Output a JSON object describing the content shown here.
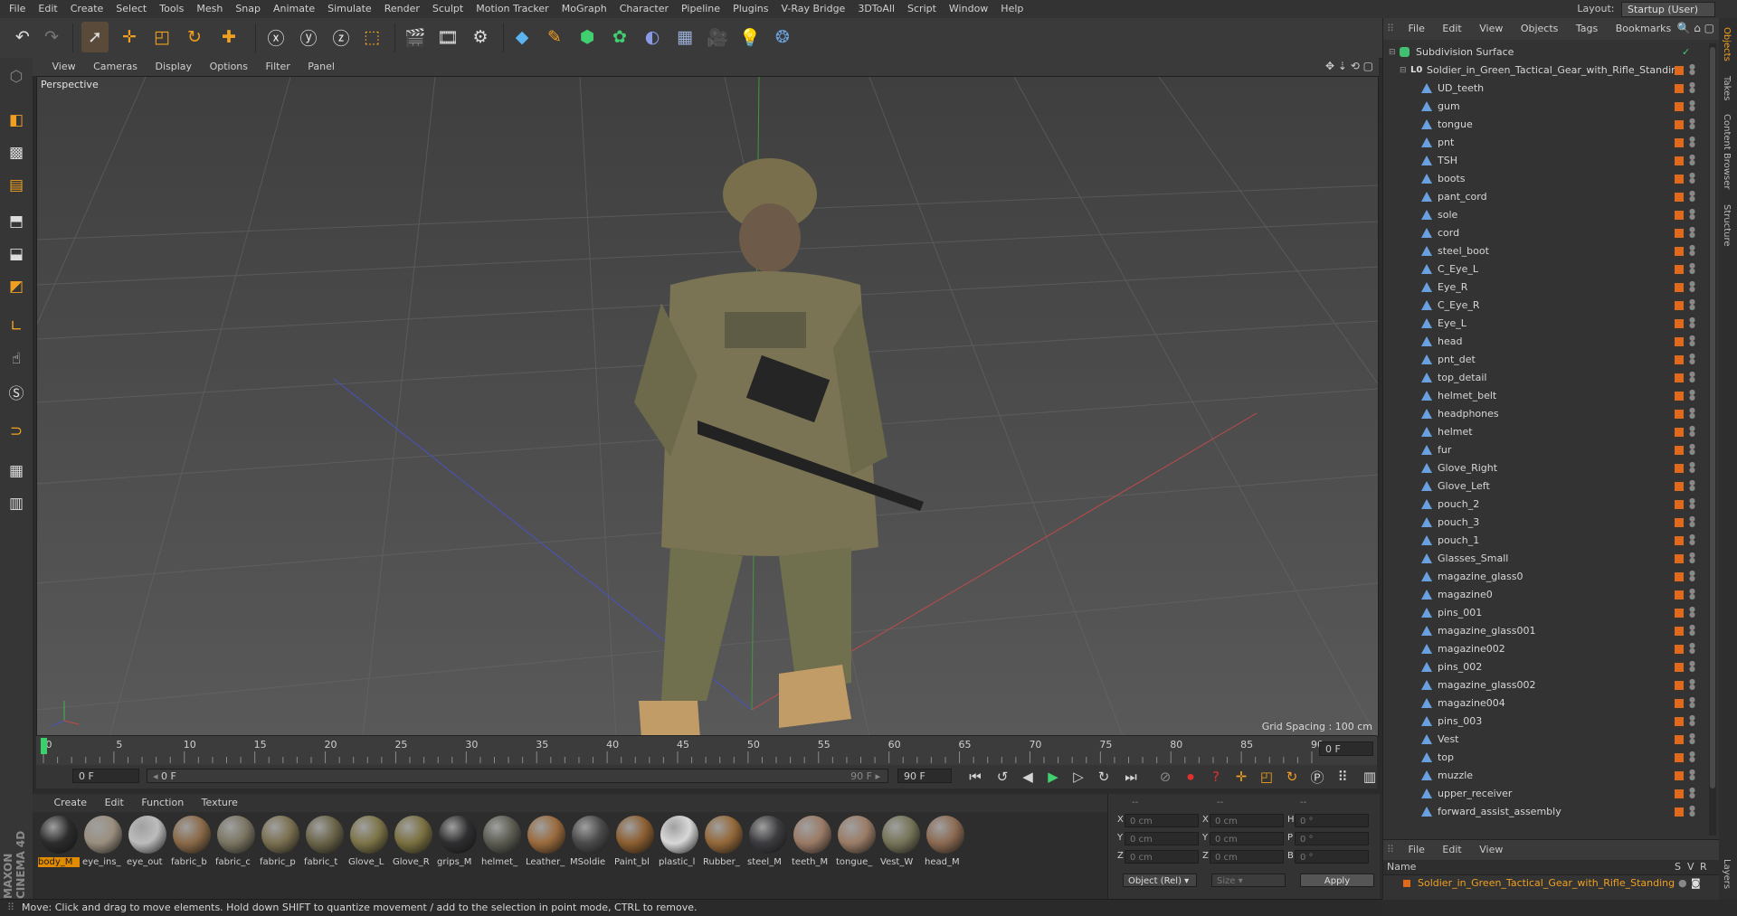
{
  "menubar": {
    "items": [
      "File",
      "Edit",
      "Create",
      "Select",
      "Tools",
      "Mesh",
      "Snap",
      "Animate",
      "Simulate",
      "Render",
      "Sculpt",
      "Motion Tracker",
      "MoGraph",
      "Character",
      "Pipeline",
      "Plugins",
      "V-Ray Bridge",
      "3DToAll",
      "Script",
      "Window",
      "Help"
    ],
    "layout_label": "Layout:",
    "layout_value": "Startup (User)"
  },
  "viewport": {
    "menu": [
      "View",
      "Cameras",
      "Display",
      "Options",
      "Filter",
      "Panel"
    ],
    "label": "Perspective",
    "grid_spacing": "Grid Spacing : 100 cm"
  },
  "timeline": {
    "ticks": [
      "0",
      "5",
      "10",
      "15",
      "20",
      "25",
      "30",
      "35",
      "40",
      "45",
      "50",
      "55",
      "60",
      "65",
      "70",
      "75",
      "80",
      "85",
      "90"
    ],
    "frame_readout": "0 F",
    "start_field": "0 F",
    "range_start": "0 F",
    "range_end": "90 F",
    "end_field": "90 F"
  },
  "materials": {
    "menu": [
      "Create",
      "Edit",
      "Function",
      "Texture"
    ],
    "items": [
      {
        "label": "body_M",
        "color": "#2c2c2c"
      },
      {
        "label": "eye_ins_",
        "color": "#9a8e7e"
      },
      {
        "label": "eye_out",
        "color": "#bcbcbc"
      },
      {
        "label": "fabric_b",
        "color": "#8a6a48"
      },
      {
        "label": "fabric_c",
        "color": "#7a7462"
      },
      {
        "label": "fabric_p",
        "color": "#7a7050"
      },
      {
        "label": "fabric_t",
        "color": "#6a6448"
      },
      {
        "label": "Glove_L",
        "color": "#7c7448"
      },
      {
        "label": "Glove_R",
        "color": "#7a7040"
      },
      {
        "label": "grips_M",
        "color": "#2e2e30"
      },
      {
        "label": "helmet_",
        "color": "#5c5c52"
      },
      {
        "label": "Leather_",
        "color": "#9a6a3c"
      },
      {
        "label": "MSoldie",
        "color": "#4a4a4a"
      },
      {
        "label": "Paint_bl",
        "color": "#8c5e30"
      },
      {
        "label": "plastic_l",
        "color": "#d8d8d8"
      },
      {
        "label": "Rubber_",
        "color": "#946838"
      },
      {
        "label": "steel_M",
        "color": "#3c3c40"
      },
      {
        "label": "teeth_M",
        "color": "#9a7a66"
      },
      {
        "label": "tongue_",
        "color": "#9a7c66"
      },
      {
        "label": "Vest_W",
        "color": "#767458"
      },
      {
        "label": "head_M",
        "color": "#8c6a52"
      }
    ]
  },
  "coords": {
    "col_headers": [
      "--",
      "--",
      "--"
    ],
    "rows": [
      {
        "a": "X",
        "av": "0 cm",
        "b": "X",
        "bv": "0 cm",
        "c": "H",
        "cv": "0 °"
      },
      {
        "a": "Y",
        "av": "0 cm",
        "b": "Y",
        "bv": "0 cm",
        "c": "P",
        "cv": "0 °"
      },
      {
        "a": "Z",
        "av": "0 cm",
        "b": "Z",
        "bv": "0 cm",
        "c": "B",
        "cv": "0 °"
      }
    ],
    "mode": "Object (Rel)",
    "size": "Size",
    "apply": "Apply"
  },
  "maxon_logo": "MAXON CINEMA 4D",
  "status": "Move: Click and drag to move elements. Hold down SHIFT to quantize movement / add to the selection in point mode, CTRL to remove.",
  "object_manager": {
    "menu": [
      "File",
      "Edit",
      "View",
      "Objects",
      "Tags",
      "Bookmarks"
    ],
    "root": "Subdivision Surface",
    "group": "Soldier_in_Green_Tactical_Gear_with_Rifle_Standing",
    "children": [
      "UD_teeth",
      "gum",
      "tongue",
      "pnt",
      "TSH",
      "boots",
      "pant_cord",
      "sole",
      "cord",
      "steel_boot",
      "C_Eye_L",
      "Eye_R",
      "C_Eye_R",
      "Eye_L",
      "head",
      "pnt_det",
      "top_detail",
      "helmet_belt",
      "headphones",
      "helmet",
      "fur",
      "Glove_Right",
      "Glove_Left",
      "pouch_2",
      "pouch_3",
      "pouch_1",
      "Glasses_Small",
      "magazine_glass0",
      "magazine0",
      "pins_001",
      "magazine_glass001",
      "magazine002",
      "pins_002",
      "magazine_glass002",
      "magazine004",
      "pins_003",
      "Vest",
      "top",
      "muzzle",
      "upper_receiver",
      "forward_assist_assembly"
    ],
    "right_tabs": [
      "Objects",
      "Takes",
      "Content Browser",
      "Structure"
    ]
  },
  "layers": {
    "menu": [
      "File",
      "Edit",
      "View"
    ],
    "name_header": "Name",
    "cols": [
      "S",
      "V",
      "R"
    ],
    "row": "Soldier_in_Green_Tactical_Gear_with_Rifle_Standing",
    "tab": "Layers"
  }
}
